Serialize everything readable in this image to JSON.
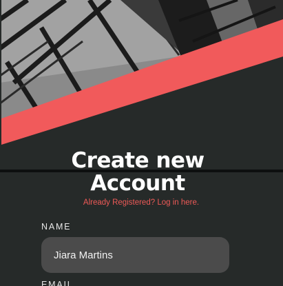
{
  "form": {
    "title_line1": "Create new",
    "title_line2": "Account",
    "login_link": "Already Registered? Log in here.",
    "name_label": "NAME",
    "name_value": "Jiara Martins",
    "email_label": "EMAIL"
  },
  "colors": {
    "background": "#262a29",
    "accent": "#f15a5b",
    "input_bg": "#4b4b4b",
    "text": "#ffffff"
  },
  "icons": {
    "hero": "building-ceiling-image"
  }
}
